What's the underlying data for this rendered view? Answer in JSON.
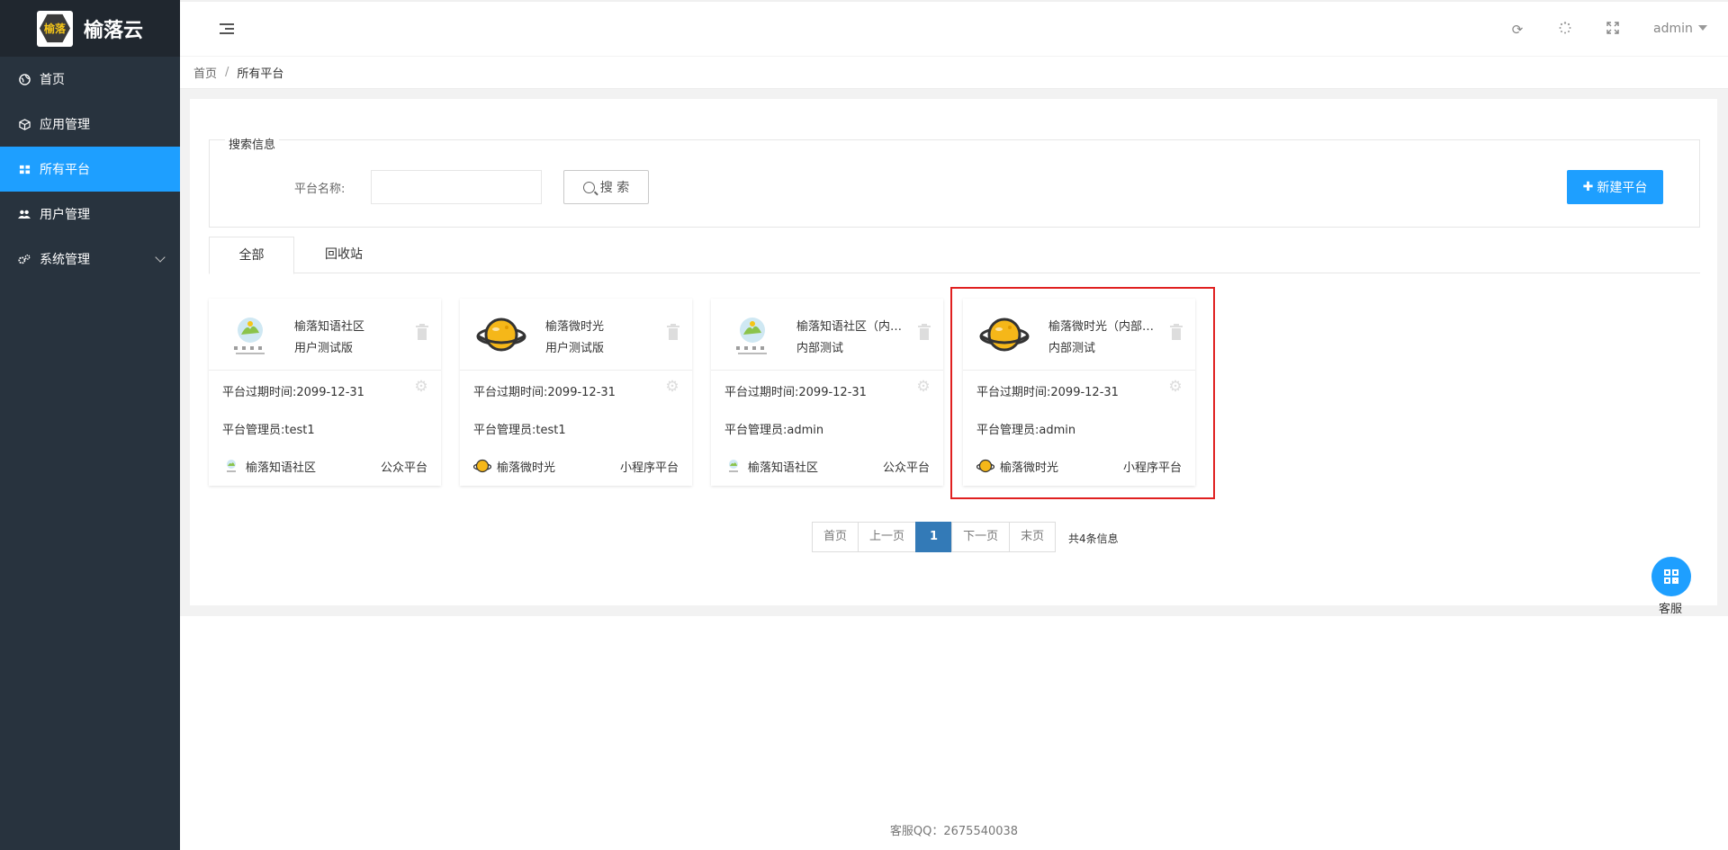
{
  "app": {
    "logo_text": "榆落云",
    "logo_badge": "榆落"
  },
  "sidebar": {
    "items": [
      {
        "label": "首页",
        "icon": "globe-icon"
      },
      {
        "label": "应用管理",
        "icon": "cube-icon"
      },
      {
        "label": "所有平台",
        "icon": "grid-icon",
        "active": true
      },
      {
        "label": "用户管理",
        "icon": "users-icon"
      },
      {
        "label": "系统管理",
        "icon": "cogs-icon"
      }
    ]
  },
  "header": {
    "user": "admin",
    "icons": [
      "refresh-icon",
      "loading-icon",
      "fullscreen-icon"
    ]
  },
  "breadcrumb": {
    "home": "首页",
    "sep": "/",
    "current": "所有平台"
  },
  "search": {
    "legend": "搜索信息",
    "label": "平台名称:",
    "input_value": "",
    "button": "搜 索",
    "new_button": "新建平台"
  },
  "tabs": [
    "全部",
    "回收站"
  ],
  "platforms": [
    {
      "title": "榆落知语社区",
      "subtitle": "用户测试版",
      "expire_label": "平台过期时间:",
      "expire": "2099-12-31",
      "admin_label": "平台管理员:",
      "admin": "test1",
      "app_name": "榆落知语社区",
      "type": "公众平台",
      "logo": "community-logo"
    },
    {
      "title": "榆落微时光",
      "subtitle": "用户测试版",
      "expire_label": "平台过期时间:",
      "expire": "2099-12-31",
      "admin_label": "平台管理员:",
      "admin": "test1",
      "app_name": "榆落微时光",
      "type": "小程序平台",
      "logo": "planet-logo"
    },
    {
      "title": "榆落知语社区（内部测试）",
      "subtitle": "内部测试",
      "expire_label": "平台过期时间:",
      "expire": "2099-12-31",
      "admin_label": "平台管理员:",
      "admin": "admin",
      "app_name": "榆落知语社区",
      "type": "公众平台",
      "logo": "community-logo"
    },
    {
      "title": "榆落微时光（内部测试）",
      "subtitle": "内部测试",
      "expire_label": "平台过期时间:",
      "expire": "2099-12-31",
      "admin_label": "平台管理员:",
      "admin": "admin",
      "app_name": "榆落微时光",
      "type": "小程序平台",
      "logo": "planet-logo"
    }
  ],
  "pagination": {
    "first": "首页",
    "prev": "上一页",
    "current": "1",
    "next": "下一页",
    "last": "末页",
    "info": "共4条信息"
  },
  "customer_service": {
    "label": "客服"
  },
  "footer": {
    "text": "客服QQ：2675540038"
  },
  "colors": {
    "sidebar": "#28333e",
    "accent": "#1e9fff",
    "page_active": "#337ab7",
    "highlight": "#e02020"
  }
}
